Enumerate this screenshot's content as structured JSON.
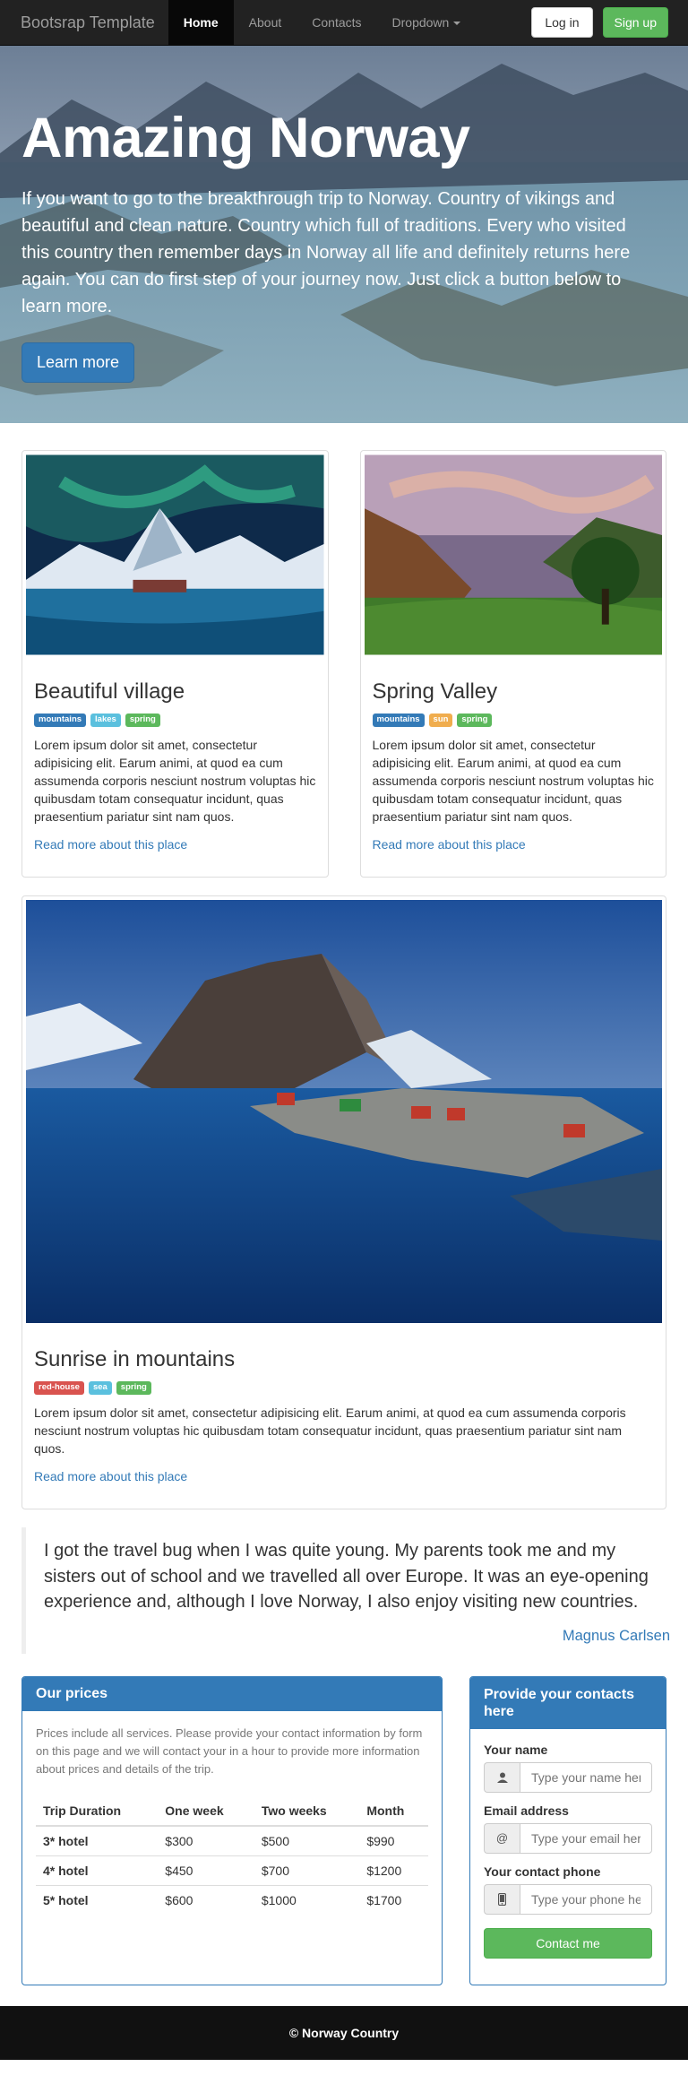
{
  "navbar": {
    "brand": "Bootsrap Template",
    "items": [
      {
        "label": "Home",
        "active": true
      },
      {
        "label": "About"
      },
      {
        "label": "Contacts"
      },
      {
        "label": "Dropdown"
      }
    ],
    "login_label": "Log in",
    "signup_label": "Sign up"
  },
  "hero": {
    "title": "Amazing Norway",
    "text": "If you want to go to the breakthrough trip to Norway. Country of vikings and beautiful and clean nature. Country which full of traditions. Every who visited this country then remember days in Norway all life and definitely returns here again. You can do first step of your journey now. Just click a button below to learn more.",
    "button_label": "Learn more"
  },
  "places": [
    {
      "title": "Beautiful village",
      "tags": [
        {
          "text": "mountains",
          "color": "#337ab7"
        },
        {
          "text": "lakes",
          "color": "#5bc0de"
        },
        {
          "text": "spring",
          "color": "#5cb85c"
        }
      ],
      "text": "Lorem ipsum dolor sit amet, consectetur adipisicing elit. Earum animi, at quod ea cum assumenda corporis nesciunt nostrum voluptas hic quibusdam totam consequatur incidunt, quas praesentium pariatur sint nam quos.",
      "link": "Read more about this place"
    },
    {
      "title": "Spring Valley",
      "tags": [
        {
          "text": "mountains",
          "color": "#337ab7"
        },
        {
          "text": "sun",
          "color": "#f0ad4e"
        },
        {
          "text": "spring",
          "color": "#5cb85c"
        }
      ],
      "text": "Lorem ipsum dolor sit amet, consectetur adipisicing elit. Earum animi, at quod ea cum assumenda corporis nesciunt nostrum voluptas hic quibusdam totam consequatur incidunt, quas praesentium pariatur sint nam quos.",
      "link": "Read more about this place"
    },
    {
      "title": "Sunrise in mountains",
      "tags": [
        {
          "text": "red-house",
          "color": "#d9534f"
        },
        {
          "text": "sea",
          "color": "#5bc0de"
        },
        {
          "text": "spring",
          "color": "#5cb85c"
        }
      ],
      "text": "Lorem ipsum dolor sit amet, consectetur adipisicing elit. Earum animi, at quod ea cum assumenda corporis nesciunt nostrum voluptas hic quibusdam totam consequatur incidunt, quas praesentium pariatur sint nam quos.",
      "link": "Read more about this place"
    }
  ],
  "quote": {
    "text": "I got the travel bug when I was quite young. My parents took me and my sisters out of school and we travelled all over Europe. It was an eye-opening experience and, although I love Norway, I also enjoy visiting new countries.",
    "author": "Magnus Carlsen"
  },
  "prices": {
    "heading": "Our prices",
    "intro": "Prices include all services. Please provide your contact information by form on this page and we will contact your in a hour to provide more information about prices and details of the trip.",
    "columns": [
      "Trip Duration",
      "One week",
      "Two weeks",
      "Month"
    ],
    "rows": [
      [
        "3* hotel",
        "$300",
        "$500",
        "$990"
      ],
      [
        "4* hotel",
        "$450",
        "$700",
        "$1200"
      ],
      [
        "5* hotel",
        "$600",
        "$1000",
        "$1700"
      ]
    ]
  },
  "contact": {
    "heading": "Provide your contacts here",
    "name_label": "Your name",
    "name_placeholder": "Type your name here",
    "email_label": "Email address",
    "email_placeholder": "Type your email here",
    "phone_label": "Your contact phone",
    "phone_placeholder": "Type your phone here",
    "button_label": "Contact me"
  },
  "footer": {
    "text": "© Norway Country"
  },
  "icons": {
    "user": "user-icon",
    "at": "at-icon",
    "phone": "phone-icon"
  }
}
